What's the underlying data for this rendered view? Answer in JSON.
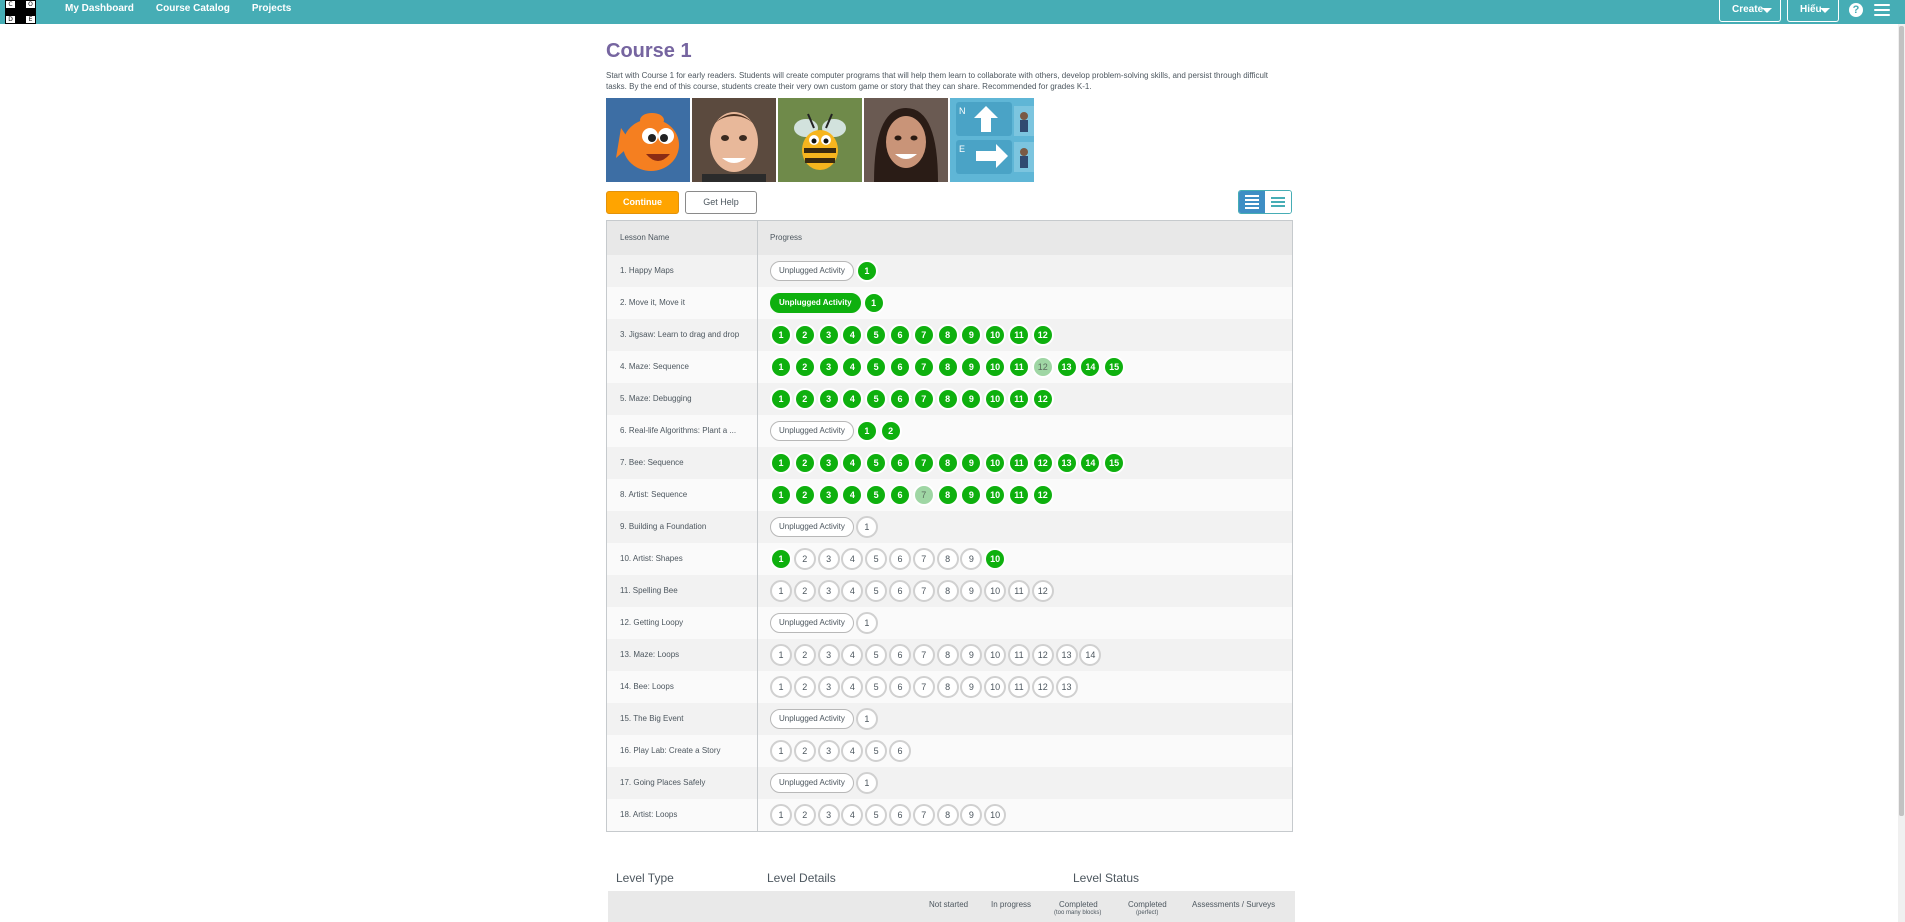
{
  "header": {
    "logo_letters": [
      "C",
      "O",
      "D",
      "E"
    ],
    "nav": [
      "My Dashboard",
      "Course Catalog",
      "Projects"
    ],
    "create_label": "Create",
    "user_label": "Hiếu",
    "help_glyph": "?"
  },
  "course": {
    "title": "Course 1",
    "description": "Start with Course 1 for early readers. Students will create computer programs that will help them learn to collaborate with others, develop problem-solving skills, and persist through difficult tasks. By the end of this course, students create their very own custom game or story that they can share. Recommended for grades K-1."
  },
  "buttons": {
    "continue": "Continue",
    "get_help": "Get Help"
  },
  "table": {
    "col_name": "Lesson Name",
    "col_progress": "Progress",
    "unplugged_label": "Unplugged Activity",
    "lessons": [
      {
        "name": "1. Happy Maps",
        "unplugged": "todo",
        "levels": [
          [
            "1",
            "done"
          ]
        ]
      },
      {
        "name": "2. Move it, Move it",
        "unplugged": "done",
        "levels": [
          [
            "1",
            "done"
          ]
        ]
      },
      {
        "name": "3. Jigsaw: Learn to drag and drop",
        "levels": [
          [
            "1",
            "done"
          ],
          [
            "2",
            "done"
          ],
          [
            "3",
            "done"
          ],
          [
            "4",
            "done"
          ],
          [
            "5",
            "done"
          ],
          [
            "6",
            "done"
          ],
          [
            "7",
            "done"
          ],
          [
            "8",
            "done"
          ],
          [
            "9",
            "done"
          ],
          [
            "10",
            "done"
          ],
          [
            "11",
            "done"
          ],
          [
            "12",
            "done"
          ]
        ]
      },
      {
        "name": "4. Maze: Sequence",
        "levels": [
          [
            "1",
            "done"
          ],
          [
            "2",
            "done"
          ],
          [
            "3",
            "done"
          ],
          [
            "4",
            "done"
          ],
          [
            "5",
            "done"
          ],
          [
            "6",
            "done"
          ],
          [
            "7",
            "done"
          ],
          [
            "8",
            "done"
          ],
          [
            "9",
            "done"
          ],
          [
            "10",
            "done"
          ],
          [
            "11",
            "done"
          ],
          [
            "12",
            "partial"
          ],
          [
            "13",
            "done"
          ],
          [
            "14",
            "done"
          ],
          [
            "15",
            "done"
          ]
        ]
      },
      {
        "name": "5. Maze: Debugging",
        "levels": [
          [
            "1",
            "done"
          ],
          [
            "2",
            "done"
          ],
          [
            "3",
            "done"
          ],
          [
            "4",
            "done"
          ],
          [
            "5",
            "done"
          ],
          [
            "6",
            "done"
          ],
          [
            "7",
            "done"
          ],
          [
            "8",
            "done"
          ],
          [
            "9",
            "done"
          ],
          [
            "10",
            "done"
          ],
          [
            "11",
            "done"
          ],
          [
            "12",
            "done"
          ]
        ]
      },
      {
        "name": "6. Real-life Algorithms: Plant a ...",
        "unplugged": "todo",
        "levels": [
          [
            "1",
            "done"
          ],
          [
            "2",
            "done"
          ]
        ]
      },
      {
        "name": "7. Bee: Sequence",
        "levels": [
          [
            "1",
            "done"
          ],
          [
            "2",
            "done"
          ],
          [
            "3",
            "done"
          ],
          [
            "4",
            "done"
          ],
          [
            "5",
            "done"
          ],
          [
            "6",
            "done"
          ],
          [
            "7",
            "done"
          ],
          [
            "8",
            "done"
          ],
          [
            "9",
            "done"
          ],
          [
            "10",
            "done"
          ],
          [
            "11",
            "done"
          ],
          [
            "12",
            "done"
          ],
          [
            "13",
            "done"
          ],
          [
            "14",
            "done"
          ],
          [
            "15",
            "done"
          ]
        ]
      },
      {
        "name": "8. Artist: Sequence",
        "levels": [
          [
            "1",
            "done"
          ],
          [
            "2",
            "done"
          ],
          [
            "3",
            "done"
          ],
          [
            "4",
            "done"
          ],
          [
            "5",
            "done"
          ],
          [
            "6",
            "done"
          ],
          [
            "7",
            "partial"
          ],
          [
            "8",
            "done"
          ],
          [
            "9",
            "done"
          ],
          [
            "10",
            "done"
          ],
          [
            "11",
            "done"
          ],
          [
            "12",
            "done"
          ]
        ]
      },
      {
        "name": "9. Building a Foundation",
        "unplugged": "todo",
        "levels": [
          [
            "1",
            "todo"
          ]
        ]
      },
      {
        "name": "10. Artist: Shapes",
        "levels": [
          [
            "1",
            "done"
          ],
          [
            "2",
            "todo"
          ],
          [
            "3",
            "todo"
          ],
          [
            "4",
            "todo"
          ],
          [
            "5",
            "todo"
          ],
          [
            "6",
            "todo"
          ],
          [
            "7",
            "todo"
          ],
          [
            "8",
            "todo"
          ],
          [
            "9",
            "todo"
          ],
          [
            "10",
            "done"
          ]
        ]
      },
      {
        "name": "11. Spelling Bee",
        "levels": [
          [
            "1",
            "todo"
          ],
          [
            "2",
            "todo"
          ],
          [
            "3",
            "todo"
          ],
          [
            "4",
            "todo"
          ],
          [
            "5",
            "todo"
          ],
          [
            "6",
            "todo"
          ],
          [
            "7",
            "todo"
          ],
          [
            "8",
            "todo"
          ],
          [
            "9",
            "todo"
          ],
          [
            "10",
            "todo"
          ],
          [
            "11",
            "todo"
          ],
          [
            "12",
            "todo"
          ]
        ]
      },
      {
        "name": "12. Getting Loopy",
        "unplugged": "todo",
        "levels": [
          [
            "1",
            "todo"
          ]
        ]
      },
      {
        "name": "13. Maze: Loops",
        "levels": [
          [
            "1",
            "todo"
          ],
          [
            "2",
            "todo"
          ],
          [
            "3",
            "todo"
          ],
          [
            "4",
            "todo"
          ],
          [
            "5",
            "todo"
          ],
          [
            "6",
            "todo"
          ],
          [
            "7",
            "todo"
          ],
          [
            "8",
            "todo"
          ],
          [
            "9",
            "todo"
          ],
          [
            "10",
            "todo"
          ],
          [
            "11",
            "todo"
          ],
          [
            "12",
            "todo"
          ],
          [
            "13",
            "todo"
          ],
          [
            "14",
            "todo"
          ]
        ]
      },
      {
        "name": "14. Bee: Loops",
        "levels": [
          [
            "1",
            "todo"
          ],
          [
            "2",
            "todo"
          ],
          [
            "3",
            "todo"
          ],
          [
            "4",
            "todo"
          ],
          [
            "5",
            "todo"
          ],
          [
            "6",
            "todo"
          ],
          [
            "7",
            "todo"
          ],
          [
            "8",
            "todo"
          ],
          [
            "9",
            "todo"
          ],
          [
            "10",
            "todo"
          ],
          [
            "11",
            "todo"
          ],
          [
            "12",
            "todo"
          ],
          [
            "13",
            "todo"
          ]
        ]
      },
      {
        "name": "15. The Big Event",
        "unplugged": "todo",
        "levels": [
          [
            "1",
            "todo"
          ]
        ]
      },
      {
        "name": "16. Play Lab: Create a Story",
        "levels": [
          [
            "1",
            "todo"
          ],
          [
            "2",
            "todo"
          ],
          [
            "3",
            "todo"
          ],
          [
            "4",
            "todo"
          ],
          [
            "5",
            "todo"
          ],
          [
            "6",
            "todo"
          ]
        ]
      },
      {
        "name": "17. Going Places Safely",
        "unplugged": "todo",
        "levels": [
          [
            "1",
            "todo"
          ]
        ]
      },
      {
        "name": "18. Artist: Loops",
        "levels": [
          [
            "1",
            "todo"
          ],
          [
            "2",
            "todo"
          ],
          [
            "3",
            "todo"
          ],
          [
            "4",
            "todo"
          ],
          [
            "5",
            "todo"
          ],
          [
            "6",
            "todo"
          ],
          [
            "7",
            "todo"
          ],
          [
            "8",
            "todo"
          ],
          [
            "9",
            "todo"
          ],
          [
            "10",
            "todo"
          ]
        ]
      }
    ]
  },
  "key": {
    "level_type": "Level Type",
    "level_details": "Level Details",
    "level_status": "Level Status",
    "not_started": "Not started",
    "in_progress": "In progress",
    "completed_too_many": "Completed",
    "completed_too_many_sub": "(too many blocks)",
    "completed_perfect": "Completed",
    "completed_perfect_sub": "(perfect)",
    "assessments": "Assessments / Surveys"
  },
  "colors": {
    "header": "#46adb5",
    "title": "#7665a0",
    "continue": "#ffa400",
    "complete": "#0eb00e",
    "partial": "#9fd6a4"
  }
}
